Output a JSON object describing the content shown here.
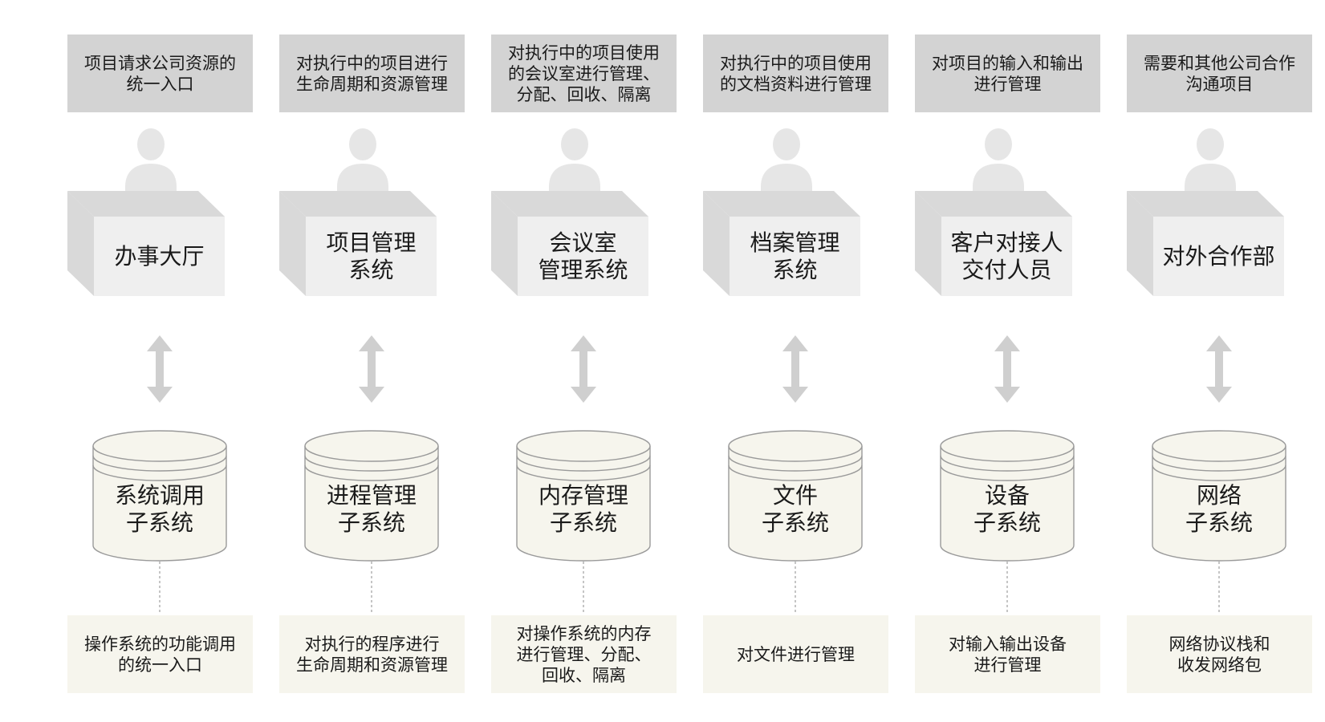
{
  "columns": [
    {
      "top_note": "项目请求公司资源的\n统一入口",
      "desk": "办事大厅",
      "database": "系统调用\n子系统",
      "bottom_note": "操作系统的功能调用\n的统一入口"
    },
    {
      "top_note": "对执行中的项目进行\n生命周期和资源管理",
      "desk": "项目管理\n系统",
      "database": "进程管理\n子系统",
      "bottom_note": "对执行的程序进行\n生命周期和资源管理"
    },
    {
      "top_note": "对执行中的项目使用\n的会议室进行管理、\n分配、回收、隔离",
      "desk": "会议室\n管理系统",
      "database": "内存管理\n子系统",
      "bottom_note": "对操作系统的内存\n进行管理、分配、\n回收、隔离"
    },
    {
      "top_note": "对执行中的项目使用\n的文档资料进行管理",
      "desk": "档案管理\n系统",
      "database": "文件\n子系统",
      "bottom_note": "对文件进行管理"
    },
    {
      "top_note": "对项目的输入和输出\n进行管理",
      "desk": "客户对接人\n交付人员",
      "database": "设备\n子系统",
      "bottom_note": "对输入输出设备\n进行管理"
    },
    {
      "top_note": "需要和其他公司合作\n沟通项目",
      "desk": "对外合作部",
      "database": "网络\n子系统",
      "bottom_note": "网络协议栈和\n收发网络包"
    }
  ],
  "colors": {
    "top_note_bg": "#d3d3d3",
    "bottom_note_bg": "#f6f5ed",
    "desk_front": "#efefef",
    "desk_side": "#d9d9d9",
    "person": "#e6e6e6",
    "arrow": "#cfcfcf",
    "database_fill": "#f6f5ed",
    "database_stroke": "#9a9a9a"
  }
}
